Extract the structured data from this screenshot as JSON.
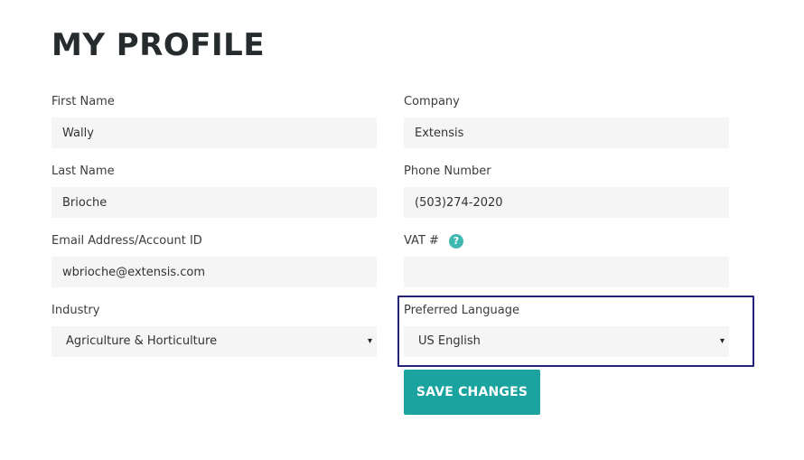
{
  "page": {
    "title": "MY PROFILE"
  },
  "fields": {
    "first_name": {
      "label": "First Name",
      "value": "Wally"
    },
    "company": {
      "label": "Company",
      "value": "Extensis"
    },
    "last_name": {
      "label": "Last Name",
      "value": "Brioche"
    },
    "phone_number": {
      "label": "Phone Number",
      "value": "(503)274-2020"
    },
    "email": {
      "label": "Email Address/Account ID",
      "value": "wbrioche@extensis.com"
    },
    "vat": {
      "label": "VAT #",
      "value": "",
      "help_icon": "question-mark-circle",
      "help_glyph": "?"
    },
    "industry": {
      "label": "Industry",
      "selected": "Agriculture & Horticulture",
      "arrow": "▾"
    },
    "preferred_language": {
      "label": "Preferred Language",
      "selected": "US English",
      "arrow": "▾"
    }
  },
  "actions": {
    "save_label": "SAVE CHANGES"
  },
  "colors": {
    "accent": "#1aa39f",
    "help_icon": "#3fb8b0",
    "highlight_border": "#23237a",
    "input_background": "#f5f5f5",
    "title": "#262b2e"
  }
}
